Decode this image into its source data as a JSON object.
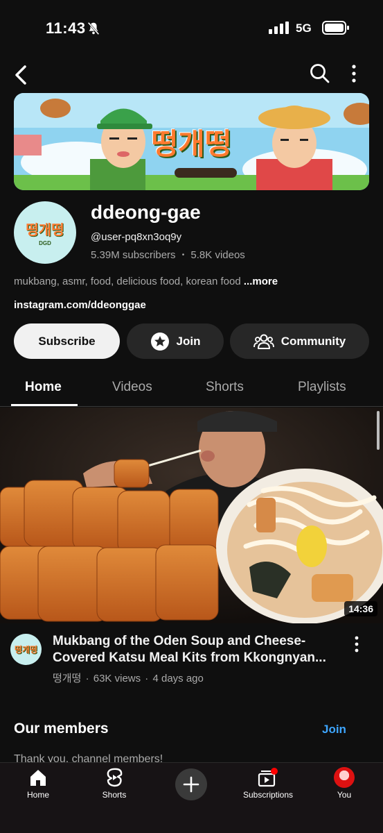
{
  "status": {
    "time": "11:43",
    "network": "5G"
  },
  "channel": {
    "banner_logo": "떵개떵",
    "avatar_text": "떵개떵",
    "avatar_sub": "DGD",
    "name": "ddeong-gae",
    "handle": "@user-pq8xn3oq9y",
    "subscribers": "5.39M subscribers",
    "videos": "5.8K videos",
    "stats_separator": "•",
    "description": "mukbang, asmr, food, delicious food, korean food",
    "more_label": "...more",
    "link": "instagram.com/ddeonggae"
  },
  "actions": {
    "subscribe_label": "Subscribe",
    "join_label": "Join",
    "community_label": "Community"
  },
  "tabs": [
    {
      "label": "Home",
      "active": true
    },
    {
      "label": "Videos",
      "active": false
    },
    {
      "label": "Shorts",
      "active": false
    },
    {
      "label": "Playlists",
      "active": false
    }
  ],
  "featured_video": {
    "duration": "14:36",
    "title": "Mukbang of the Oden Soup and Cheese-Covered Katsu Meal Kits from Kkongnyan...",
    "channel": "떵개떵",
    "views": "63K views",
    "age": "4 days ago",
    "separator": "·",
    "avatar_text": "떵개떵"
  },
  "members": {
    "title": "Our members",
    "join_label": "Join",
    "thanks": "Thank you, channel members!"
  },
  "bottom_nav": [
    {
      "label": "Home",
      "icon": "home-icon"
    },
    {
      "label": "Shorts",
      "icon": "shorts-icon"
    },
    {
      "label": "",
      "icon": "create-icon"
    },
    {
      "label": "Subscriptions",
      "icon": "subscriptions-icon"
    },
    {
      "label": "You",
      "icon": "profile-avatar"
    }
  ],
  "colors": {
    "background": "#0f0f0f",
    "accent_link": "#3ea6ff",
    "subscribe_bg": "#f1f1f1",
    "chip_bg": "#272727",
    "notification_dot": "#ff0000"
  }
}
